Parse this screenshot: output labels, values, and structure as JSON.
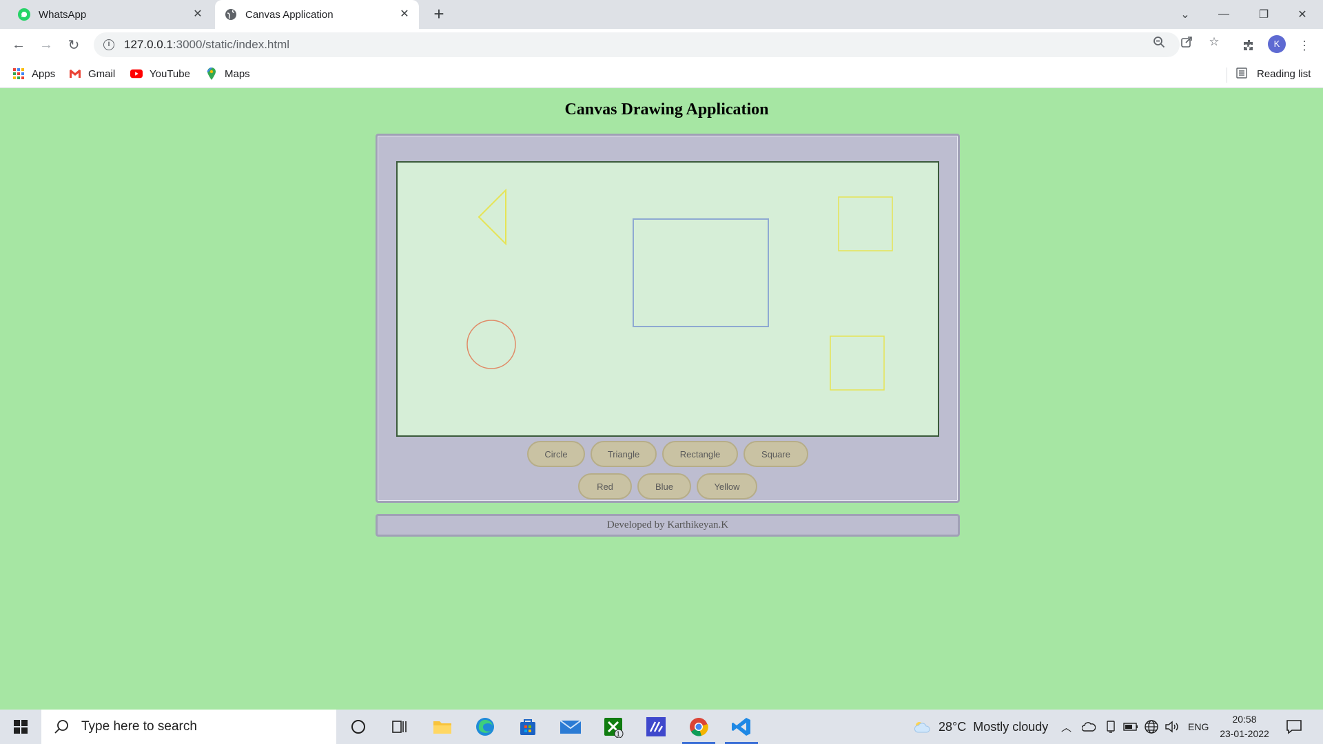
{
  "browser": {
    "tabs": [
      {
        "title": "WhatsApp",
        "icon": "whatsapp-icon",
        "active": false
      },
      {
        "title": "Canvas Application",
        "icon": "globe-icon",
        "active": true
      }
    ],
    "url_host": "127.0.0.1",
    "url_path": ":3000/static/index.html",
    "profile_initial": "K",
    "bookmarks": [
      "Apps",
      "Gmail",
      "YouTube",
      "Maps"
    ],
    "reading_list": "Reading list"
  },
  "page": {
    "title": "Canvas Drawing Application",
    "shape_buttons": [
      "Circle",
      "Triangle",
      "Rectangle",
      "Square"
    ],
    "color_buttons": [
      "Red",
      "Blue",
      "Yellow"
    ],
    "footer": "Developed by Karthikeyan.K",
    "background_color": "#a6e6a3",
    "panel_color": "#bdbdd0",
    "canvas_color": "#d6eed7"
  },
  "canvas_shapes": [
    {
      "shape": "triangle",
      "color": "yellow"
    },
    {
      "shape": "rectangle",
      "color": "blue"
    },
    {
      "shape": "square",
      "color": "yellow"
    },
    {
      "shape": "circle",
      "color": "red"
    },
    {
      "shape": "square",
      "color": "yellow"
    }
  ],
  "taskbar": {
    "search_placeholder": "Type here to search",
    "weather": "28°C  Mostly cloudy",
    "language": "ENG",
    "time": "20:58",
    "date": "23-01-2022",
    "mail_badge": "1"
  }
}
